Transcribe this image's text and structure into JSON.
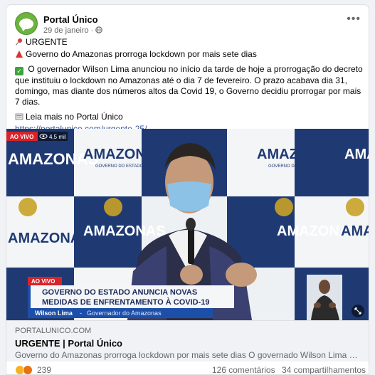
{
  "post": {
    "page_name": "Portal Único",
    "date": "29 de janeiro",
    "meta_separator": "·",
    "privacy_icon": "globe-icon",
    "more_icon": "more-options-icon"
  },
  "body": {
    "line1": "URGENTE",
    "line2": "Governo do Amazonas prorroga lockdown por mais sete dias",
    "line3": "O governador Wilson Lima anunciou no início da tarde de hoje  a prorrogação do decreto que instituiu o lockdown no Amazonas até o dia 7 de fevereiro. O prazo acabava dia 31, domingo, mas diante dos números altos da Covid 19, o Governo decidiu prorrogar por mais 7 dias.",
    "read_more": "Leia mais no Portal Único",
    "url": "https://portalunico.com/urgente-25/"
  },
  "media": {
    "live_badge": "AO VIVO",
    "viewers": "4,5 mil",
    "banner_live": "AO VIVO",
    "headline_line1": "GOVERNO DO ESTADO ANUNCIA NOVAS",
    "headline_line2": "MEDIDAS DE ENFRENTAMENTO À COVID-19",
    "speaker_name": "Wilson Lima",
    "speaker_role": "Governador do Amazonas",
    "backdrop_word": "AMAZONAS",
    "backdrop_sub": "GOVERNO DO ESTADO"
  },
  "link_preview": {
    "domain": "PORTALUNICO.COM",
    "title": "URGENTE | Portal Único",
    "description": "Governo do Amazonas prorroga lockdown por mais sete dias O governado Wilson Lima anunc..."
  },
  "footer": {
    "reaction_count": "239",
    "comments": "126 comentários",
    "shares": "34 compartilhamentos"
  },
  "colors": {
    "brand_green": "#6cb33f",
    "link_blue": "#385898",
    "backdrop_navy": "#1f3a73",
    "banner_blue": "#1c4fa8",
    "live_red": "#d8232a"
  }
}
